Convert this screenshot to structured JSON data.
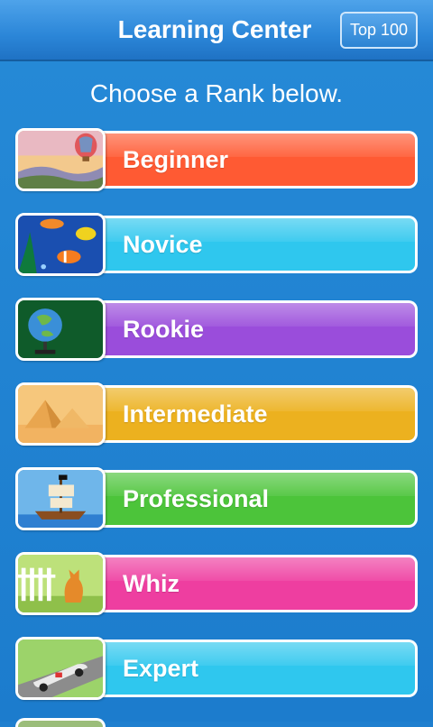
{
  "header": {
    "title": "Learning Center",
    "top_button_label": "Top 100"
  },
  "main": {
    "subtitle": "Choose a Rank below.",
    "ranks": [
      {
        "label": "Beginner",
        "color": "#ff5a33",
        "icon": "hot-air-balloon-icon"
      },
      {
        "label": "Novice",
        "color": "#2fc7ee",
        "icon": "tropical-fish-icon"
      },
      {
        "label": "Rookie",
        "color": "#9a4ddb",
        "icon": "globe-icon"
      },
      {
        "label": "Intermediate",
        "color": "#ecb11f",
        "icon": "pyramids-icon"
      },
      {
        "label": "Professional",
        "color": "#4cc43a",
        "icon": "pirate-ship-icon"
      },
      {
        "label": "Whiz",
        "color": "#ee3ea0",
        "icon": "cat-fence-icon"
      },
      {
        "label": "Expert",
        "color": "#2fc7ee",
        "icon": "race-car-icon"
      }
    ]
  }
}
